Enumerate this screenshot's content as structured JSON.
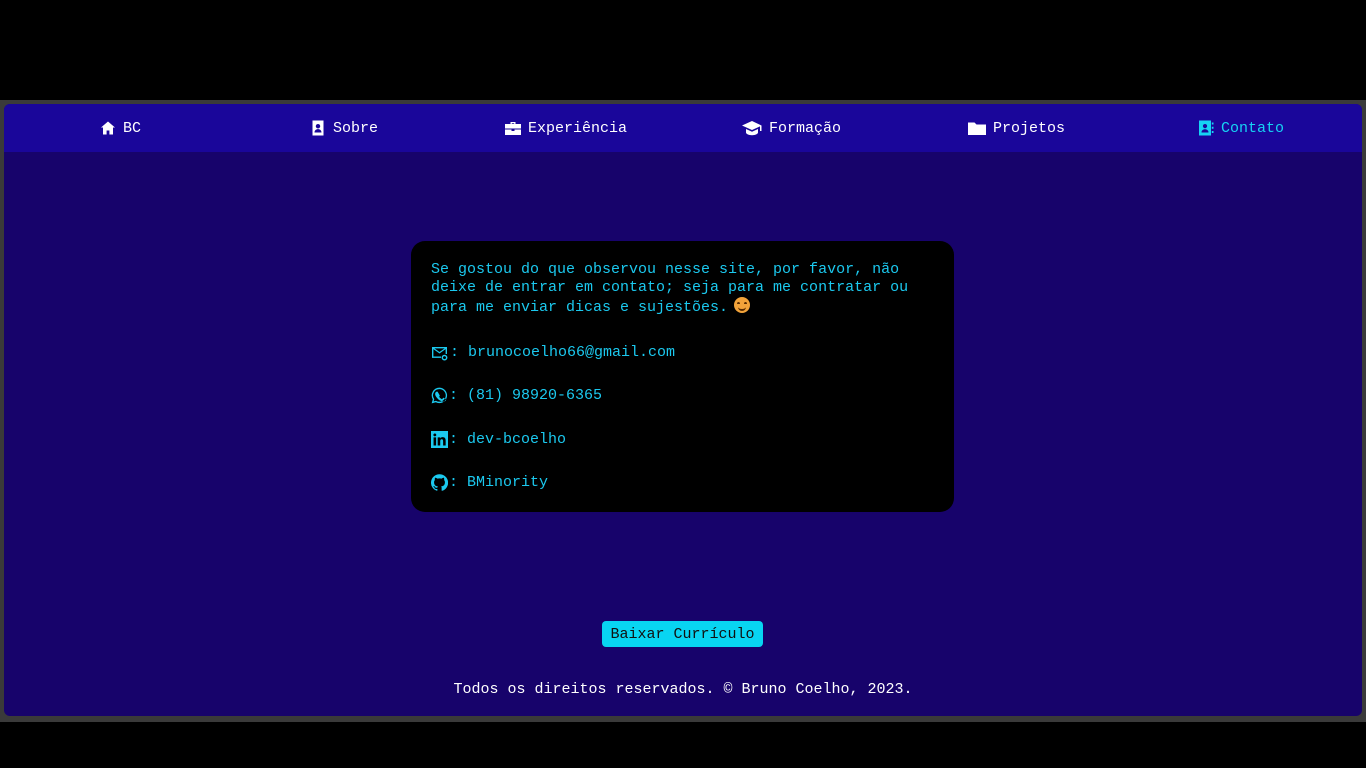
{
  "nav": {
    "items": [
      {
        "label": "BC",
        "icon": "home-icon"
      },
      {
        "label": "Sobre",
        "icon": "contact-card-icon"
      },
      {
        "label": "Experiência",
        "icon": "briefcase-icon"
      },
      {
        "label": "Formação",
        "icon": "graduation-cap-icon"
      },
      {
        "label": "Projetos",
        "icon": "folder-icon"
      },
      {
        "label": "Contato",
        "icon": "address-book-icon",
        "active": true
      }
    ]
  },
  "contact": {
    "intro": "Se gostou do que observou nesse site, por favor, não deixe de entrar em contato; seja para me contratar ou para me enviar dicas e sujestões.",
    "separator": ":",
    "email": "brunocoelho66@gmail.com",
    "phone": "(81) 98920-6365",
    "linkedin": "dev-bcoelho",
    "github": "BMinority"
  },
  "download_button": "Baixar Currículo",
  "footer": "Todos os direitos reservados. © Bruno Coelho, 2023.",
  "colors": {
    "page_background": "#17036b",
    "navbar_background": "#1a069a",
    "accent": "#16d3f4",
    "card_background": "#000000"
  }
}
